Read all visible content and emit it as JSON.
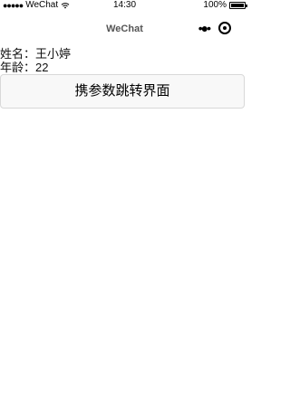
{
  "status_bar": {
    "signal": "●●●●●",
    "carrier": "WeChat",
    "time": "14:30",
    "battery_text": "100%",
    "battery_level": 1.0
  },
  "nav": {
    "title": "WeChat",
    "more_icon": "more-dots-icon",
    "record_icon": "record-icon"
  },
  "info": {
    "name_label": "姓名：",
    "name_value": "王小婷",
    "age_label": "年龄：",
    "age_value": "22"
  },
  "button": {
    "label": "携参数跳转界面"
  }
}
